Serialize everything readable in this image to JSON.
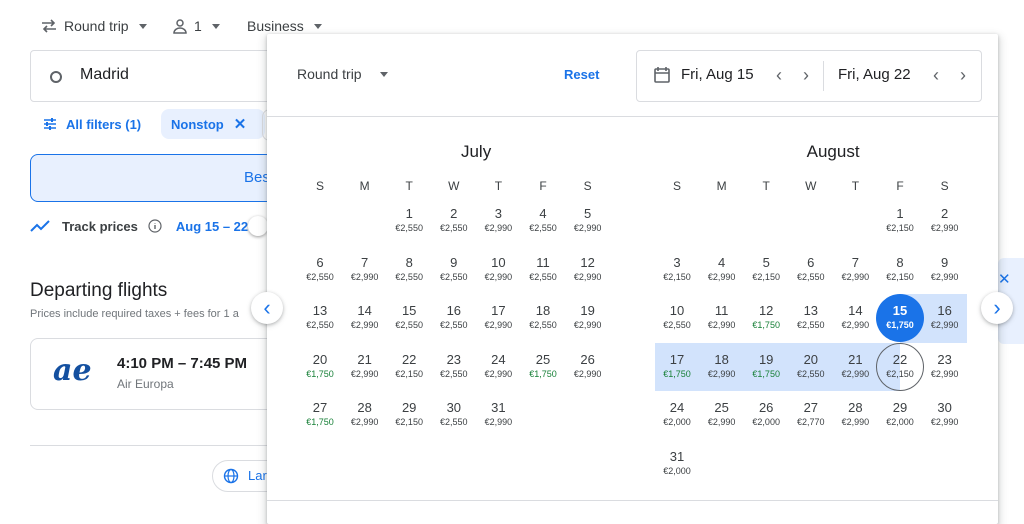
{
  "topbar": {
    "trip_type": "Round trip",
    "passengers": "1",
    "cabin": "Business"
  },
  "search": {
    "origin": "Madrid",
    "button_label": "Bes"
  },
  "filters": {
    "all_filters": "All filters (1)",
    "nonstop": "Nonstop"
  },
  "track": {
    "label": "Track prices",
    "dates": "Aug 15 – 22"
  },
  "departing": {
    "title": "Departing flights",
    "subtitle": "Prices include required taxes + fees for 1 a"
  },
  "flight": {
    "logo": "ae",
    "time": "4:10 PM – 7:45 PM",
    "airline": "Air Europa"
  },
  "footer": {
    "language": "Lar"
  },
  "popup": {
    "trip_type": "Round trip",
    "reset": "Reset",
    "depart_date": "Fri, Aug 15",
    "return_date": "Fri, Aug 22",
    "weekdays": [
      "S",
      "M",
      "T",
      "W",
      "T",
      "F",
      "S"
    ],
    "months": [
      {
        "name": "July",
        "start": 2,
        "days": [
          {
            "d": "1",
            "p": "€2,550"
          },
          {
            "d": "2",
            "p": "€2,550"
          },
          {
            "d": "3",
            "p": "€2,990"
          },
          {
            "d": "4",
            "p": "€2,550"
          },
          {
            "d": "5",
            "p": "€2,990"
          },
          {
            "d": "6",
            "p": "€2,550"
          },
          {
            "d": "7",
            "p": "€2,990"
          },
          {
            "d": "8",
            "p": "€2,550"
          },
          {
            "d": "9",
            "p": "€2,550"
          },
          {
            "d": "10",
            "p": "€2,990"
          },
          {
            "d": "11",
            "p": "€2,550"
          },
          {
            "d": "12",
            "p": "€2,990"
          },
          {
            "d": "13",
            "p": "€2,550"
          },
          {
            "d": "14",
            "p": "€2,990"
          },
          {
            "d": "15",
            "p": "€2,550"
          },
          {
            "d": "16",
            "p": "€2,550"
          },
          {
            "d": "17",
            "p": "€2,990"
          },
          {
            "d": "18",
            "p": "€2,550"
          },
          {
            "d": "19",
            "p": "€2,990"
          },
          {
            "d": "20",
            "p": "€1,750",
            "low": true
          },
          {
            "d": "21",
            "p": "€2,990"
          },
          {
            "d": "22",
            "p": "€2,150"
          },
          {
            "d": "23",
            "p": "€2,550"
          },
          {
            "d": "24",
            "p": "€2,990"
          },
          {
            "d": "25",
            "p": "€1,750",
            "low": true
          },
          {
            "d": "26",
            "p": "€2,990"
          },
          {
            "d": "27",
            "p": "€1,750",
            "low": true
          },
          {
            "d": "28",
            "p": "€2,990"
          },
          {
            "d": "29",
            "p": "€2,150"
          },
          {
            "d": "30",
            "p": "€2,550"
          },
          {
            "d": "31",
            "p": "€2,990"
          }
        ]
      },
      {
        "name": "August",
        "start": 5,
        "days": [
          {
            "d": "1",
            "p": "€2,150"
          },
          {
            "d": "2",
            "p": "€2,990"
          },
          {
            "d": "3",
            "p": "€2,150"
          },
          {
            "d": "4",
            "p": "€2,990"
          },
          {
            "d": "5",
            "p": "€2,150"
          },
          {
            "d": "6",
            "p": "€2,550"
          },
          {
            "d": "7",
            "p": "€2,990"
          },
          {
            "d": "8",
            "p": "€2,150"
          },
          {
            "d": "9",
            "p": "€2,990"
          },
          {
            "d": "10",
            "p": "€2,550"
          },
          {
            "d": "11",
            "p": "€2,990"
          },
          {
            "d": "12",
            "p": "€1,750",
            "low": true
          },
          {
            "d": "13",
            "p": "€2,550"
          },
          {
            "d": "14",
            "p": "€2,990"
          },
          {
            "d": "15",
            "p": "€1,750",
            "sel": true
          },
          {
            "d": "16",
            "p": "€2,990"
          },
          {
            "d": "17",
            "p": "€1,750",
            "low": true
          },
          {
            "d": "18",
            "p": "€2,990"
          },
          {
            "d": "19",
            "p": "€1,750",
            "low": true
          },
          {
            "d": "20",
            "p": "€2,550"
          },
          {
            "d": "21",
            "p": "€2,990"
          },
          {
            "d": "22",
            "p": "€2,150",
            "ring": true
          },
          {
            "d": "23",
            "p": "€2,990"
          },
          {
            "d": "24",
            "p": "€2,000"
          },
          {
            "d": "25",
            "p": "€2,990"
          },
          {
            "d": "26",
            "p": "€2,000"
          },
          {
            "d": "27",
            "p": "€2,770"
          },
          {
            "d": "28",
            "p": "€2,990"
          },
          {
            "d": "29",
            "p": "€2,000"
          },
          {
            "d": "30",
            "p": "€2,990"
          },
          {
            "d": "31",
            "p": "€2,000"
          }
        ]
      }
    ]
  },
  "colors": {
    "accent": "#1a73e8",
    "range": "#d2e3fc",
    "low_price": "#188038"
  }
}
